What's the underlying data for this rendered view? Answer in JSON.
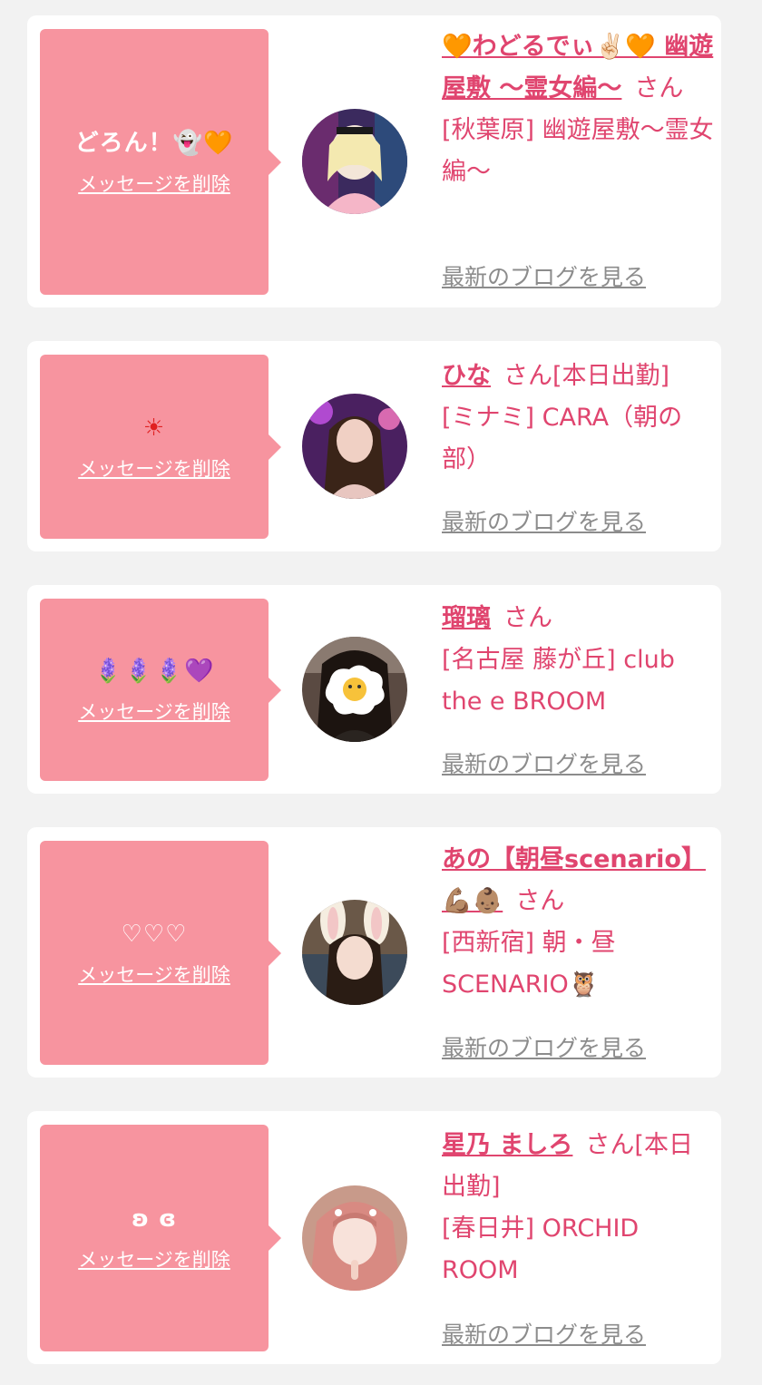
{
  "items": [
    {
      "message": "どろん！👻🧡",
      "delete_label": "メッセージを削除",
      "name": "🧡わどるでぃ✌🏻🧡 幽遊屋敷 〜霊女編〜",
      "honorific": "さん",
      "shop": "[秋葉原] 幽遊屋敷〜霊女編〜",
      "blog_label": "最新のブログを見る",
      "avatar_desc": "pink-gothic-maid-avatar"
    },
    {
      "message": "☀",
      "delete_label": "メッセージを削除",
      "name": "ひな",
      "honorific": "さん[本日出勤]",
      "shop": "[ミナミ] CARA（朝の部）",
      "blog_label": "最新のブログを見る",
      "avatar_desc": "purple-neon-avatar"
    },
    {
      "message": "🪻🪻🪻💜",
      "delete_label": "メッセージを削除",
      "name": "瑠璃",
      "honorific": "さん",
      "shop": "[名古屋 藤が丘] club the e BROOM",
      "blog_label": "最新のブログを見る",
      "avatar_desc": "fried-egg-sticker-avatar"
    },
    {
      "message": "♡♡♡",
      "delete_label": "メッセージを削除",
      "name": "あの【朝昼scenario】💪🏽👶🏽",
      "honorific": "さん",
      "shop": "[西新宿] 朝・昼SCENARIO🦉",
      "blog_label": "最新のブログを見る",
      "avatar_desc": "bunny-ears-avatar"
    },
    {
      "message": "ʚ ɞ",
      "delete_label": "メッセージを削除",
      "name": "星乃 ましろ",
      "honorific": "さん[本日出勤]",
      "shop": "[春日井] ORCHID ROOM",
      "blog_label": "最新のブログを見る",
      "avatar_desc": "pink-hair-avatar"
    }
  ]
}
